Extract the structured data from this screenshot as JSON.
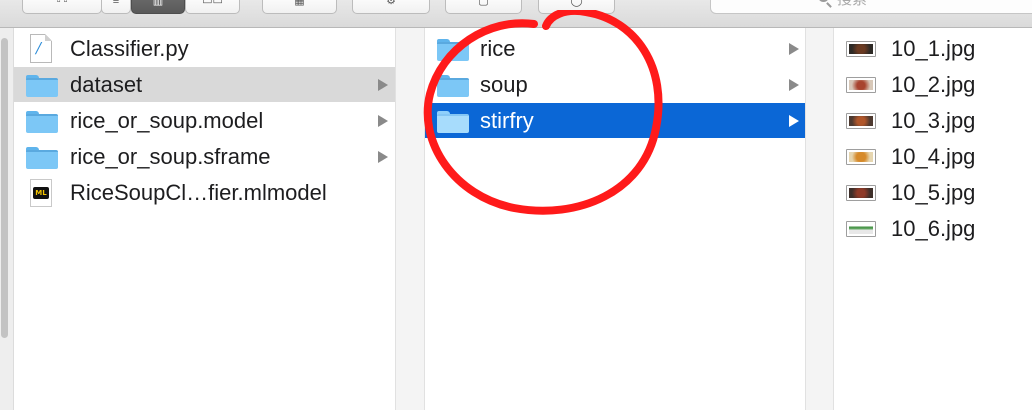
{
  "toolbar": {
    "search_placeholder": "搜索"
  },
  "columns": {
    "col1": [
      {
        "label": "Classifier.py",
        "icon": "python-file-icon",
        "has_children": false,
        "selected": false
      },
      {
        "label": "dataset",
        "icon": "folder-icon",
        "has_children": true,
        "selected": true
      },
      {
        "label": "rice_or_soup.model",
        "icon": "folder-icon",
        "has_children": true,
        "selected": false
      },
      {
        "label": "rice_or_soup.sframe",
        "icon": "folder-icon",
        "has_children": true,
        "selected": false
      },
      {
        "label": "RiceSoupCl…fier.mlmodel",
        "icon": "mlmodel-file-icon",
        "badge": "ML",
        "has_children": false,
        "selected": false
      }
    ],
    "col2": [
      {
        "label": "rice",
        "icon": "folder-icon",
        "has_children": true,
        "selected": false
      },
      {
        "label": "soup",
        "icon": "folder-icon",
        "has_children": true,
        "selected": false
      },
      {
        "label": "stirfry",
        "icon": "folder-icon",
        "has_children": true,
        "selected": true
      }
    ],
    "col3": [
      {
        "label": "10_1.jpg",
        "icon": "image-thumbnail-icon"
      },
      {
        "label": "10_2.jpg",
        "icon": "image-thumbnail-icon"
      },
      {
        "label": "10_3.jpg",
        "icon": "image-thumbnail-icon"
      },
      {
        "label": "10_4.jpg",
        "icon": "image-thumbnail-icon"
      },
      {
        "label": "10_5.jpg",
        "icon": "image-thumbnail-icon"
      },
      {
        "label": "10_6.jpg",
        "icon": "image-thumbnail-icon"
      }
    ]
  },
  "colors": {
    "selection_blue": "#0b67d6",
    "selection_gray": "#d9d9d9",
    "folder_blue": "#7cc7f6",
    "annotation_red": "#ff1a1a"
  }
}
